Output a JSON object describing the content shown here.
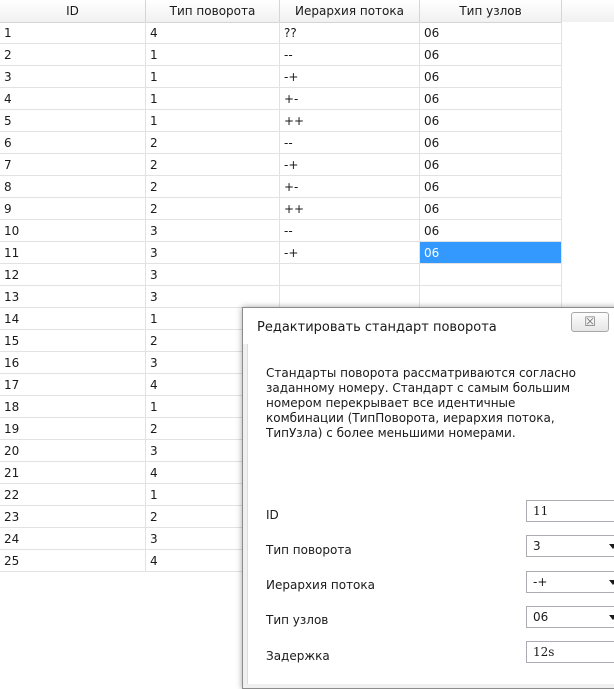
{
  "table": {
    "columns": [
      "ID",
      "Тип поворота",
      "Иерархия потока",
      "Тип узлов"
    ],
    "rows": [
      [
        "1",
        "4",
        "??",
        "06"
      ],
      [
        "2",
        "1",
        "--",
        "06"
      ],
      [
        "3",
        "1",
        "-+",
        "06"
      ],
      [
        "4",
        "1",
        "+-",
        "06"
      ],
      [
        "5",
        "1",
        "++",
        "06"
      ],
      [
        "6",
        "2",
        "--",
        "06"
      ],
      [
        "7",
        "2",
        "-+",
        "06"
      ],
      [
        "8",
        "2",
        "+-",
        "06"
      ],
      [
        "9",
        "2",
        "++",
        "06"
      ],
      [
        "10",
        "3",
        "--",
        "06"
      ],
      [
        "11",
        "3",
        "-+",
        "06"
      ],
      [
        "12",
        "3",
        "",
        ""
      ],
      [
        "13",
        "3",
        "",
        ""
      ],
      [
        "14",
        "1",
        "",
        ""
      ],
      [
        "15",
        "2",
        "",
        ""
      ],
      [
        "16",
        "3",
        "",
        ""
      ],
      [
        "17",
        "4",
        "",
        ""
      ],
      [
        "18",
        "1",
        "",
        ""
      ],
      [
        "19",
        "2",
        "",
        ""
      ],
      [
        "20",
        "3",
        "",
        ""
      ],
      [
        "21",
        "4",
        "",
        ""
      ],
      [
        "22",
        "1",
        "",
        ""
      ],
      [
        "23",
        "2",
        "",
        ""
      ],
      [
        "24",
        "3",
        "",
        ""
      ],
      [
        "25",
        "4",
        "",
        ""
      ]
    ],
    "selected_row": 10,
    "selected_col": 3
  },
  "dialog": {
    "title": "Редактировать стандарт поворота",
    "close_glyph": "☒",
    "description": "Стандарты поворота рассматриваются согласно заданному номеру. Стандарт с самым большим номером перекрывает все идентичные комбинации (ТипПоворота, иерархия потока, ТипУзла) с более меньшими номерами.",
    "fields": {
      "id_label": "ID",
      "id_value": "11",
      "turn_type_label": "Тип поворота",
      "turn_type_value": "3",
      "flow_label": "Иерархия потока",
      "flow_value": "-+",
      "node_type_label": "Тип узлов",
      "node_type_value": "06",
      "delay_label": "Задержка",
      "delay_value": "12s"
    }
  },
  "colors": {
    "selection": "#3399ff",
    "grid_line": "#e2e2e2",
    "dialog_bg": "#f0f0f0"
  }
}
